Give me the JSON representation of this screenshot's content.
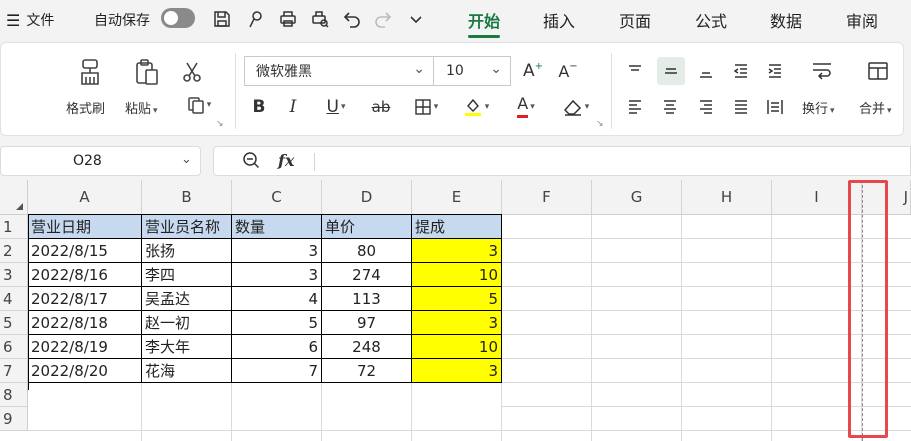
{
  "menubar": {
    "file_label": "文件",
    "autosave_label": "自动保存",
    "autosave_on": false,
    "tabs": [
      {
        "label": "开始",
        "active": true
      },
      {
        "label": "插入",
        "active": false
      },
      {
        "label": "页面",
        "active": false
      },
      {
        "label": "公式",
        "active": false
      },
      {
        "label": "数据",
        "active": false
      },
      {
        "label": "审阅",
        "active": false
      }
    ],
    "accent_color": "#1a7a42"
  },
  "ribbon": {
    "format_painter_label": "格式刷",
    "paste_label": "粘贴",
    "font_name": "微软雅黑",
    "font_size": "10",
    "bold": "B",
    "italic": "I",
    "underline": "U",
    "strike": "ab",
    "font_color_letter": "A",
    "wrap_label": "换行",
    "merge_label": "合并",
    "fill_color": "#ffff00",
    "font_color": "#e02020"
  },
  "formula_bar": {
    "name_box": "O28",
    "fx": "fx",
    "value": ""
  },
  "sheet": {
    "columns": [
      "A",
      "B",
      "C",
      "D",
      "E",
      "F",
      "G",
      "H",
      "I",
      "J"
    ],
    "rows": [
      "1",
      "2",
      "3",
      "4",
      "5",
      "6",
      "7",
      "8",
      "9"
    ],
    "header": [
      "营业日期",
      "营业员名称",
      "数量",
      "单价",
      "提成"
    ],
    "data": [
      [
        "2022/8/15",
        "张扬",
        "3",
        "80",
        "3"
      ],
      [
        "2022/8/16",
        "李四",
        "3",
        "274",
        "10"
      ],
      [
        "2022/8/17",
        "吴孟达",
        "4",
        "113",
        "5"
      ],
      [
        "2022/8/18",
        "赵一初",
        "5",
        "97",
        "3"
      ],
      [
        "2022/8/19",
        "李大年",
        "6",
        "248",
        "10"
      ],
      [
        "2022/8/20",
        "花海",
        "7",
        "72",
        "3"
      ]
    ],
    "header_fill": "#c6d9ef",
    "highlight_fill": "#ffff00",
    "highlight_box_color": "#e5484d"
  }
}
